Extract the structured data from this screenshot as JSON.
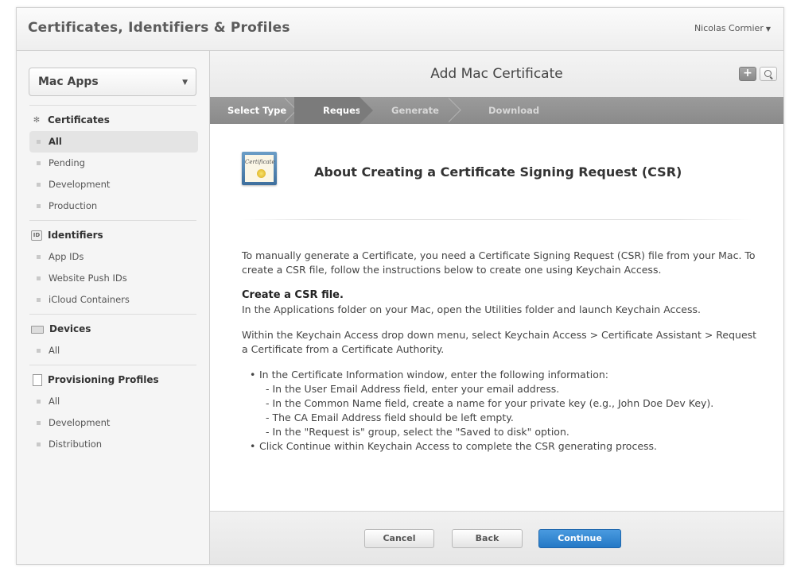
{
  "app": {
    "title": "Certificates, Identifiers & Profiles",
    "user_menu": "Nicolas Cormier"
  },
  "sidebar": {
    "platform": "Mac Apps",
    "sections": [
      {
        "title": "Certificates",
        "icon": "certificate-icon",
        "items": [
          "All",
          "Pending",
          "Development",
          "Production"
        ]
      },
      {
        "title": "Identifiers",
        "icon": "id-badge-icon",
        "badge": "ID",
        "items": [
          "App IDs",
          "Website Push IDs",
          "iCloud Containers"
        ]
      },
      {
        "title": "Devices",
        "icon": "device-icon",
        "items": [
          "All"
        ]
      },
      {
        "title": "Provisioning Profiles",
        "icon": "document-icon",
        "items": [
          "All",
          "Development",
          "Distribution"
        ]
      }
    ],
    "active_item": "Certificates/All"
  },
  "main": {
    "title": "Add Mac Certificate",
    "add_icon": "+",
    "steps": [
      "Select Type",
      "Request",
      "Generate",
      "Download"
    ],
    "current_step": "Request",
    "cert_icon_text": "Certificate",
    "heading": "About Creating a Certificate Signing Request (CSR)",
    "intro": "To manually generate a Certificate, you need a Certificate Signing Request (CSR) file from your Mac. To create a CSR file, follow the instructions below to create one using Keychain Access.",
    "section_heading": "Create a CSR file.",
    "section_text": "In the Applications folder on your Mac, open the Utilities folder and launch Keychain Access.",
    "menu_text": "Within the Keychain Access drop down menu, select Keychain Access > Certificate Assistant > Request a Certificate from a Certificate Authority.",
    "bullet1": "In the Certificate Information window, enter the following information:",
    "sub_items": [
      "- In the User Email Address field, enter your email address.",
      "- In the Common Name field, create a name for your private key (e.g., John Doe Dev Key).",
      "- The CA Email Address field should be left empty.",
      "- In the \"Request is\" group, select the \"Saved to disk\" option."
    ],
    "bullet2": "Click Continue within Keychain Access to complete the CSR generating process."
  },
  "footer": {
    "cancel": "Cancel",
    "back": "Back",
    "continue": "Continue"
  },
  "colors": {
    "accent": "#2a7fd0",
    "stepbar": "#8f8f8f",
    "step_current": "#7b7b7b"
  }
}
